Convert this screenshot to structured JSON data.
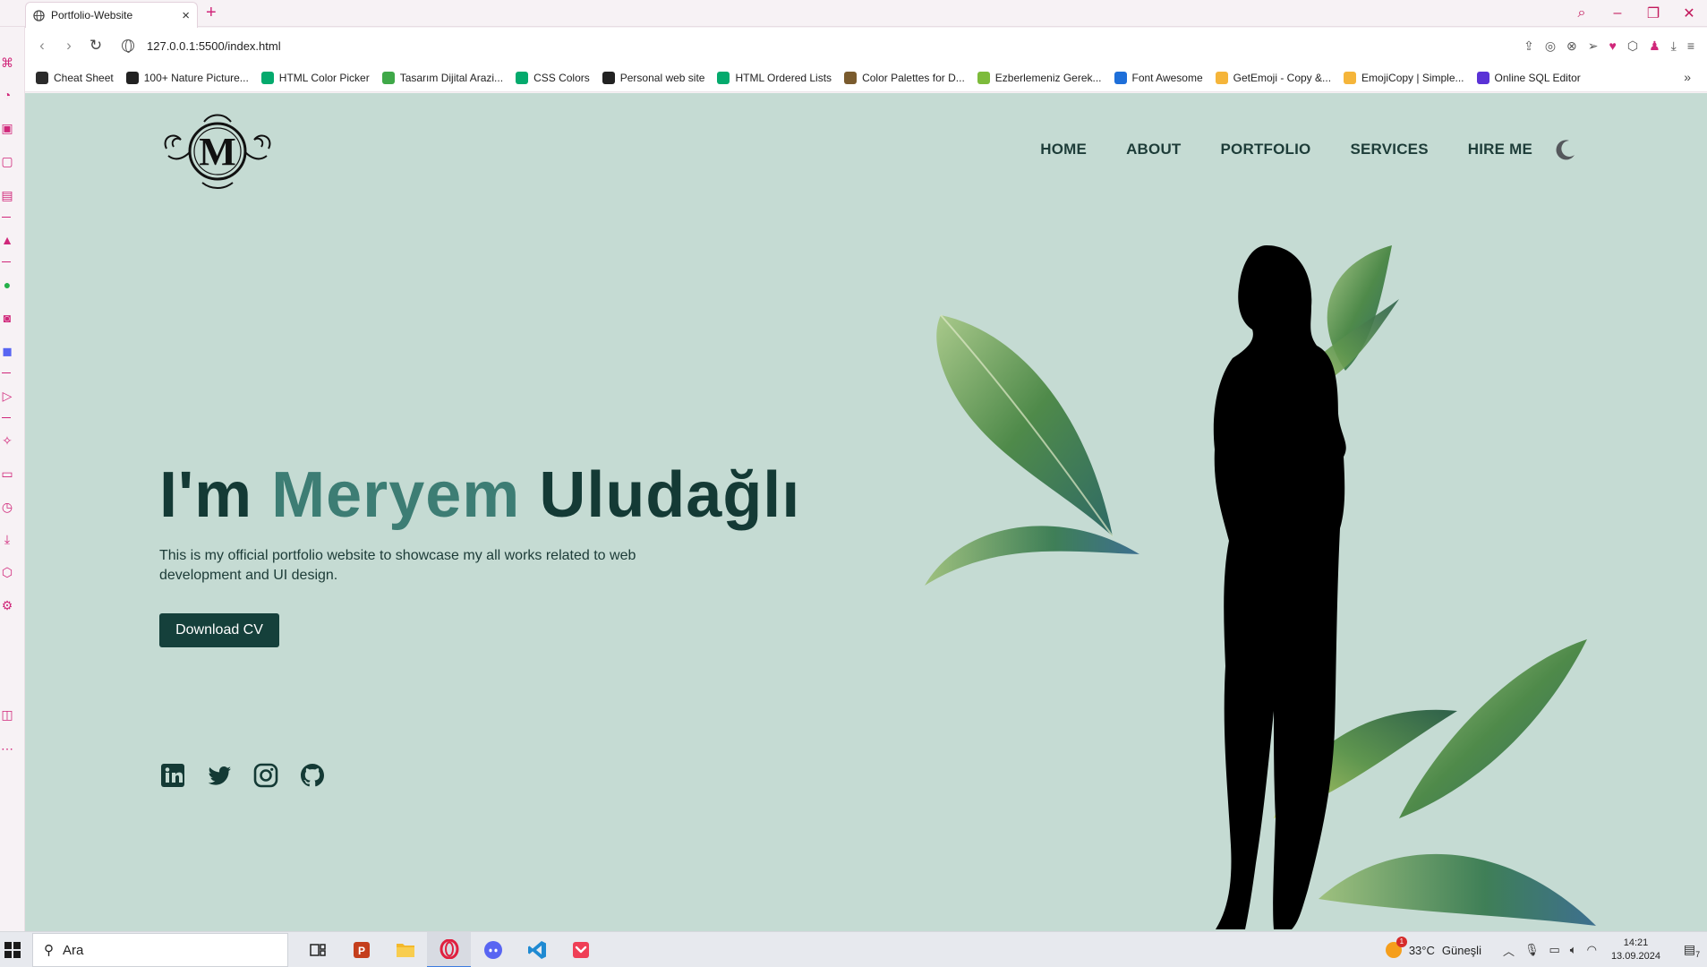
{
  "browser": {
    "tab_title": "Portfolio-Website",
    "new_tab_label": "+",
    "url": "127.0.0.1:5500/index.html",
    "accent_color": "#d0277a",
    "bookmarks": [
      {
        "label": "Cheat Sheet",
        "icon": "dark-circle-icon",
        "color": "#2b2b2b"
      },
      {
        "label": "100+ Nature Picture...",
        "icon": "image-stack-icon",
        "color": "#222222"
      },
      {
        "label": "HTML Color Picker",
        "icon": "w3schools-icon",
        "color": "#04aa6d"
      },
      {
        "label": "Tasarım Dijital Arazi...",
        "icon": "px-icon",
        "color": "#3fa848"
      },
      {
        "label": "CSS Colors",
        "icon": "w3schools-icon",
        "color": "#04aa6d"
      },
      {
        "label": "Personal web site",
        "icon": "document-icon",
        "color": "#222222"
      },
      {
        "label": "HTML Ordered Lists",
        "icon": "w3schools-icon",
        "color": "#04aa6d"
      },
      {
        "label": "Color Palettes for D...",
        "icon": "palette-cup-icon",
        "color": "#7a5b2e"
      },
      {
        "label": "Ezberlemeniz Gerek...",
        "icon": "leaf-icon",
        "color": "#7dbb3b"
      },
      {
        "label": "Font Awesome",
        "icon": "flag-icon",
        "color": "#1e6fd9"
      },
      {
        "label": "GetEmoji - Copy &...",
        "icon": "emoji-icon",
        "color": "#f5b53a"
      },
      {
        "label": "EmojiCopy | Simple...",
        "icon": "laugh-emoji-icon",
        "color": "#f5b53a"
      },
      {
        "label": "Online SQL Editor",
        "icon": "p-logo-icon",
        "color": "#5a32d6"
      }
    ],
    "bookmarks_more": "»"
  },
  "site": {
    "logo_letter": "M",
    "nav": [
      "HOME",
      "ABOUT",
      "PORTFOLIO",
      "SERVICES",
      "HIRE ME"
    ],
    "theme_toggle_icon": "moon-icon",
    "hero": {
      "prefix": "I'm ",
      "first_name": "Meryem",
      "last_name": " Uludağlı",
      "description": "This is my official portfolio website to showcase my all works related to web development and UI design.",
      "cta_label": "Download CV"
    },
    "socials": [
      "linkedin-icon",
      "twitter-icon",
      "instagram-icon",
      "github-icon"
    ],
    "colors": {
      "background": "#c5dbd3",
      "heading": "#143a35",
      "accent": "#3d7d74",
      "button": "#15403b"
    }
  },
  "taskbar": {
    "search_placeholder": "Ara",
    "temperature": "33°C",
    "weather_text": "Güneşli",
    "weather_badge": "1",
    "time": "14:21",
    "date": "13.09.2024",
    "notification_count": "7"
  }
}
